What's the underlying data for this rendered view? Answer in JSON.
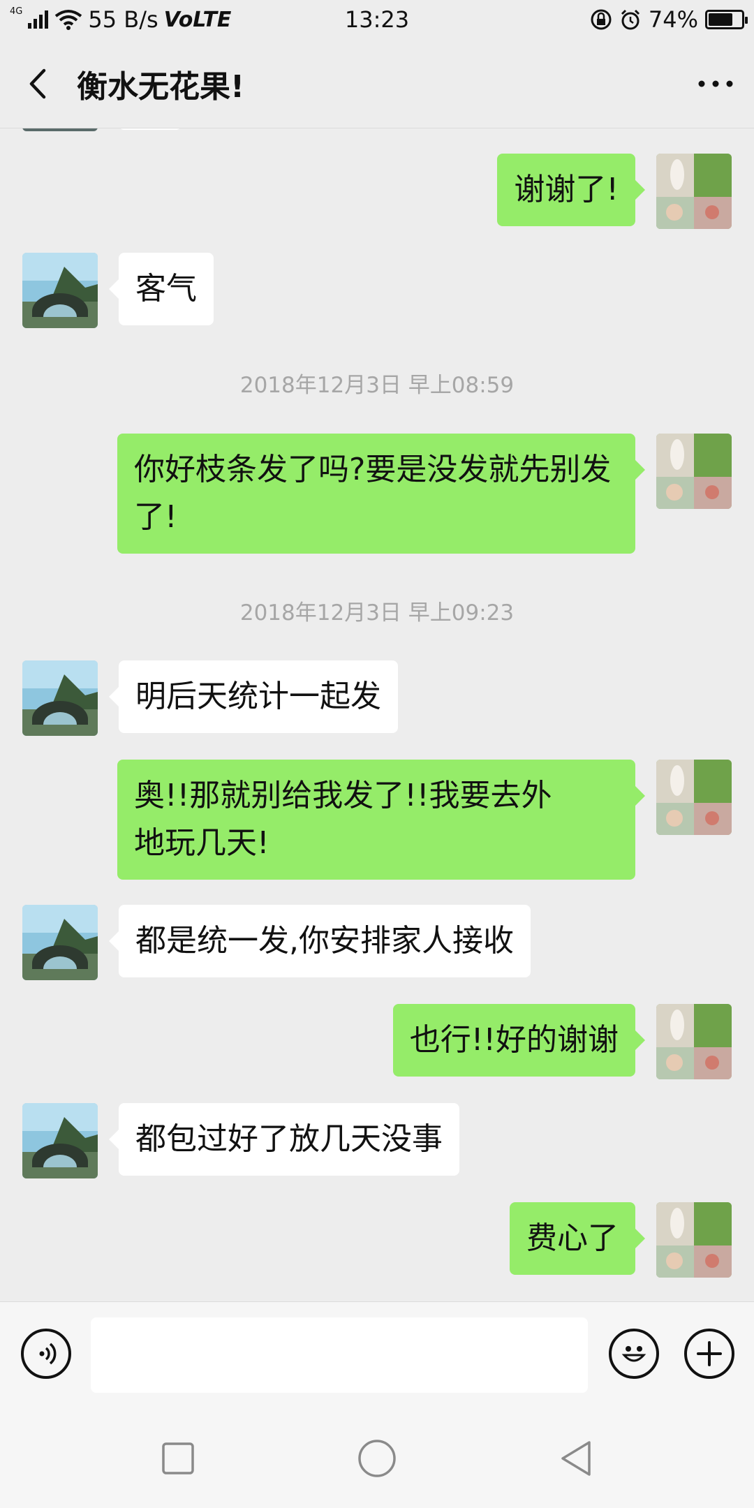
{
  "status": {
    "signal_label": "4G",
    "speed": "55 B/s",
    "volte": "VoLTE",
    "time": "13:23",
    "battery": "74%",
    "battery_level": 0.74
  },
  "header": {
    "title": "衡水无花果!"
  },
  "messages": [
    {
      "side": "right",
      "text": "谢谢了!"
    },
    {
      "side": "left",
      "text": "客气"
    },
    {
      "type": "time",
      "text": "2018年12月3日 早上08:59"
    },
    {
      "side": "right",
      "lines": [
        "你好枝条发了吗?要是没发就先别发",
        "了!"
      ]
    },
    {
      "type": "time",
      "text": "2018年12月3日 早上09:23"
    },
    {
      "side": "left",
      "text": "明后天统计一起发"
    },
    {
      "side": "right",
      "lines": [
        "奥!!那就别给我发了!!我要去外",
        "地玩几天!"
      ]
    },
    {
      "side": "left",
      "text": "都是统一发,你安排家人接收"
    },
    {
      "side": "right",
      "text": "也行!!好的谢谢"
    },
    {
      "side": "left",
      "text": "都包过好了放几天没事"
    },
    {
      "side": "right",
      "text": "费心了"
    }
  ],
  "input": {
    "placeholder": ""
  },
  "colors": {
    "bubble_self": "#95ec69",
    "bubble_other": "#ffffff",
    "background": "#ededed"
  },
  "icons": {
    "voice": "voice-icon",
    "emoji": "emoji-icon",
    "plus": "plus-icon",
    "back": "back-arrow-icon",
    "more": "more-icon"
  }
}
